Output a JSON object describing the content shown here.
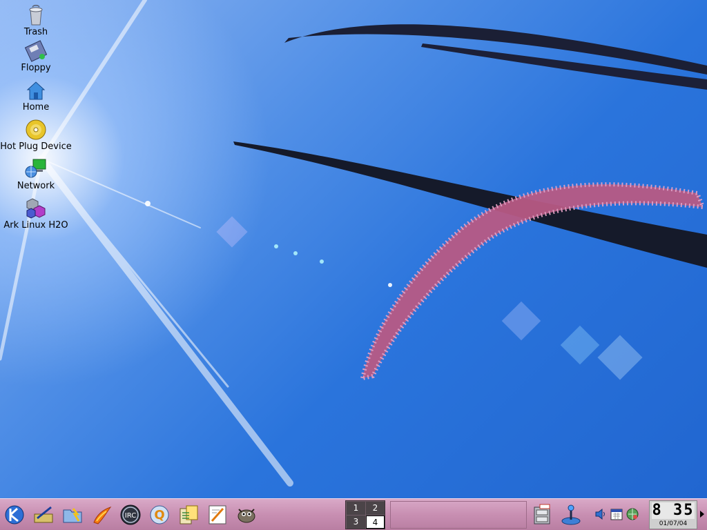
{
  "desktop_icons": [
    {
      "label": "Trash",
      "icon": "trash-icon"
    },
    {
      "label": "Floppy",
      "icon": "floppy-icon"
    },
    {
      "label": "Home",
      "icon": "home-icon"
    },
    {
      "label": "Hot Plug Device",
      "icon": "hotplug-cd-icon"
    },
    {
      "label": "Network",
      "icon": "network-icon"
    },
    {
      "label": "Ark Linux H2O",
      "icon": "ark-linux-icon"
    }
  ],
  "taskbar": {
    "launchers": [
      "kde-menu-icon",
      "control-center-icon",
      "file-manager-icon",
      "firebird-icon",
      "irc-icon",
      "q-app-icon",
      "calculator-icon",
      "editor-icon",
      "gimp-icon"
    ],
    "pager": {
      "desktops": [
        "1",
        "2",
        "3",
        "4"
      ],
      "active": "4"
    },
    "tray": [
      "file-cabinet-icon",
      "joystick-icon",
      "volume-icon",
      "calendar-icon",
      "network-monitor-icon"
    ],
    "clock": {
      "time": "8 35",
      "date": "01/07/04"
    }
  },
  "colors": {
    "sky": "#2a74dc",
    "panel": "#c88fb2",
    "grass": "#b8507a"
  }
}
